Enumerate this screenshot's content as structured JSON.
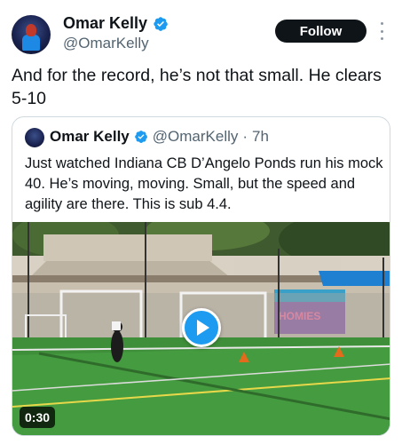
{
  "tweet": {
    "author": {
      "display_name": "Omar Kelly",
      "handle": "@OmarKelly",
      "verified": true
    },
    "follow_label": "Follow",
    "text": "And for the record, he’s not that small. He clears 5-10"
  },
  "quoted_tweet": {
    "author": {
      "display_name": "Omar Kelly",
      "handle": "@OmarKelly",
      "verified": true
    },
    "separator": "·",
    "time": "7h",
    "text": "Just watched Indiana CB D’Angelo Ponds run his mock 40. He’s moving, moving. Small, but the speed and agility are there. This is sub 4.4.",
    "media": {
      "type": "video",
      "duration": "0:30",
      "mural_text": "HOMIES"
    }
  },
  "colors": {
    "verified_blue": "#1d9bf0",
    "follow_bg": "#0f1419",
    "secondary_text": "#536471",
    "border": "#cfd9de"
  },
  "icons": {
    "verified": "verified-badge-icon",
    "more": "more-vertical-icon",
    "play": "play-icon"
  }
}
